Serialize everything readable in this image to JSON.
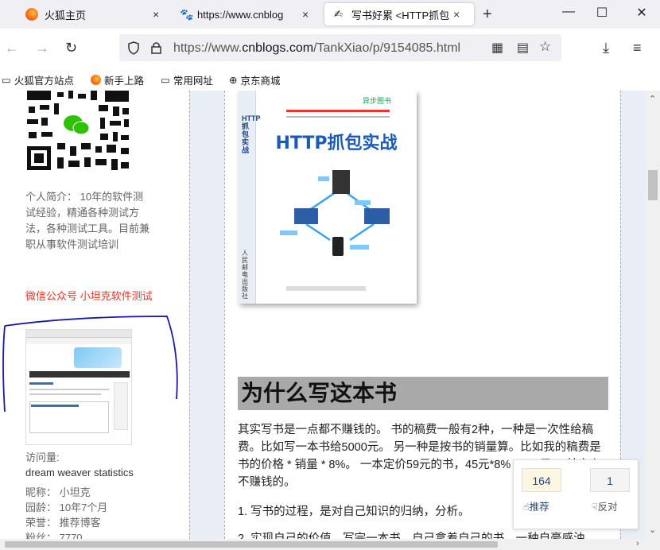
{
  "tabs": [
    {
      "label": "火狐主页",
      "close": "×"
    },
    {
      "label": "https://www.cnblog",
      "close": "×"
    },
    {
      "label": "写书好累 <HTTP抓包",
      "close": "×"
    }
  ],
  "new_tab": "+",
  "window_controls": {
    "minimize": "—",
    "maximize": "☐",
    "close": "✕"
  },
  "url": {
    "prefix": "https://www.",
    "domain": "cnblogs.com",
    "path": "/TankXiao/p/9154085.html"
  },
  "bookmarks": [
    "火狐官方站点",
    "新手上路",
    "常用网址",
    "京东商城"
  ],
  "sidebar": {
    "intro": "个人简介： 10年的软件测试经验，精通各种测试方法，各种测试工具。目前兼职从事软件测试培训",
    "wechat": "微信公众号 小坦克软件测试",
    "visits_label": "访问量:",
    "visits_value": "dream weaver statistics",
    "nickname": "昵称： 小坦克",
    "age": "园龄： 10年7个月",
    "honor": "荣誉： 推荐博客",
    "fans": "粉丝： 7770"
  },
  "book": {
    "title": "HTTP抓包实战",
    "spine": "HTTP抓包实战",
    "publisher": "人民邮电出版社",
    "logo_text": "异步图书"
  },
  "article": {
    "heading": "为什么写这本书",
    "paragraph": "其实写书是一点都不赚钱的。 书的稿费一般有2种，一种是一次性给稿费。比如写一本书给5000元。 另一种是按书的销量算。比如我的稿费是 书的价格 * 销量 * 8%。 一本定价59元的书，45元*8% = 3.6元。 基本上不赚钱的。",
    "item1": "1. 写书的过程，是对自己知识的归纳，分析。",
    "item2": "2. 实现自己的价值。写完一本书，自己拿着自己的书，一种自豪感油"
  },
  "vote": {
    "up_count": "164",
    "up_label": "推荐",
    "down_count": "1",
    "down_label": "反对"
  },
  "colors": {
    "accent_red": "#e33322",
    "heading_bg": "#a9a9a9",
    "page_bg": "#e9eef5",
    "annotation_blue": "#1a1aa8"
  }
}
